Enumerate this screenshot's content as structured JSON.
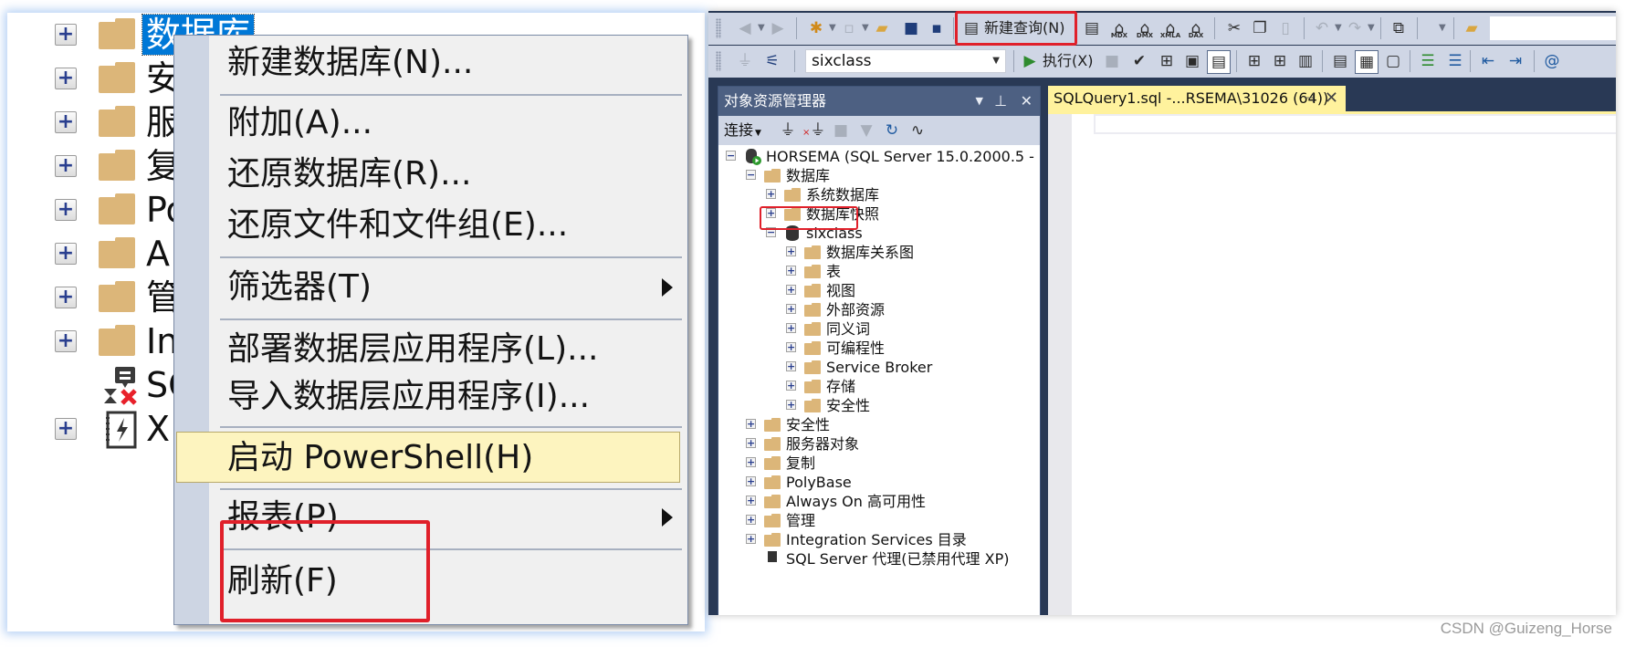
{
  "left_tree": {
    "items": [
      {
        "label": "数据库",
        "selected": true,
        "icon": "folder-icon",
        "expandable": true
      },
      {
        "label": "安",
        "icon": "folder-icon",
        "expandable": true
      },
      {
        "label": "服",
        "icon": "folder-icon",
        "expandable": true
      },
      {
        "label": "复",
        "icon": "folder-icon",
        "expandable": true
      },
      {
        "label": "Po",
        "icon": "folder-icon",
        "expandable": true
      },
      {
        "label": "A",
        "icon": "folder-icon",
        "expandable": true
      },
      {
        "label": "管",
        "icon": "folder-icon",
        "expandable": true
      },
      {
        "label": "In",
        "icon": "folder-icon",
        "expandable": true
      },
      {
        "label": "SC",
        "icon": "sql-agent-disabled-icon",
        "expandable": false
      },
      {
        "label": "X",
        "icon": "xevent-icon",
        "expandable": true
      }
    ]
  },
  "context_menu": {
    "items": [
      {
        "label": "新建数据库(N)...",
        "submenu": false
      },
      {
        "label": "附加(A)...",
        "submenu": false
      },
      {
        "label": "还原数据库(R)...",
        "submenu": false
      },
      {
        "label": "还原文件和文件组(E)...",
        "submenu": false
      },
      {
        "label": "筛选器(T)",
        "submenu": true
      },
      {
        "label": "部署数据层应用程序(L)...",
        "submenu": false
      },
      {
        "label": "导入数据层应用程序(I)...",
        "submenu": false
      },
      {
        "label": "启动 PowerShell(H)",
        "submenu": false,
        "highlighted": true
      },
      {
        "label": "报表(P)",
        "submenu": true
      },
      {
        "label": "刷新(F)",
        "submenu": false,
        "annotated": true
      }
    ]
  },
  "toolbar": {
    "new_query_label": "新建查询(N)",
    "execute_label": "执行(X)",
    "database_select": "sixclass",
    "mdx_label": "MDX",
    "dmx_label": "DMX",
    "xmla_label": "XMLA",
    "dax_label": "DAX"
  },
  "object_explorer": {
    "title": "对象资源管理器",
    "connect_label": "连接",
    "server": "HORSEMA (SQL Server 15.0.2000.5 -",
    "tree": [
      {
        "label": "数据库",
        "level": 1,
        "expanded": true
      },
      {
        "label": "系统数据库",
        "level": 2
      },
      {
        "label": "数据库快照",
        "level": 2
      },
      {
        "label": "sixclass",
        "level": 2,
        "expanded": true,
        "type": "database"
      },
      {
        "label": "数据库关系图",
        "level": 3
      },
      {
        "label": "表",
        "level": 3
      },
      {
        "label": "视图",
        "level": 3
      },
      {
        "label": "外部资源",
        "level": 3
      },
      {
        "label": "同义词",
        "level": 3
      },
      {
        "label": "可编程性",
        "level": 3
      },
      {
        "label": "Service Broker",
        "level": 3
      },
      {
        "label": "存储",
        "level": 3
      },
      {
        "label": "安全性",
        "level": 3
      },
      {
        "label": "安全性",
        "level": 1
      },
      {
        "label": "服务器对象",
        "level": 1
      },
      {
        "label": "复制",
        "level": 1
      },
      {
        "label": "PolyBase",
        "level": 1
      },
      {
        "label": "Always On 高可用性",
        "level": 1
      },
      {
        "label": "管理",
        "level": 1
      },
      {
        "label": "Integration Services 目录",
        "level": 1
      },
      {
        "label": "SQL Server 代理(已禁用代理 XP)",
        "level": 1,
        "type": "agent"
      }
    ]
  },
  "editor": {
    "tab_title": "SQLQuery1.sql -...RSEMA\\31026 (64))"
  },
  "annotation_color": "#e0202a",
  "watermark": "CSDN @Guizeng_Horse"
}
